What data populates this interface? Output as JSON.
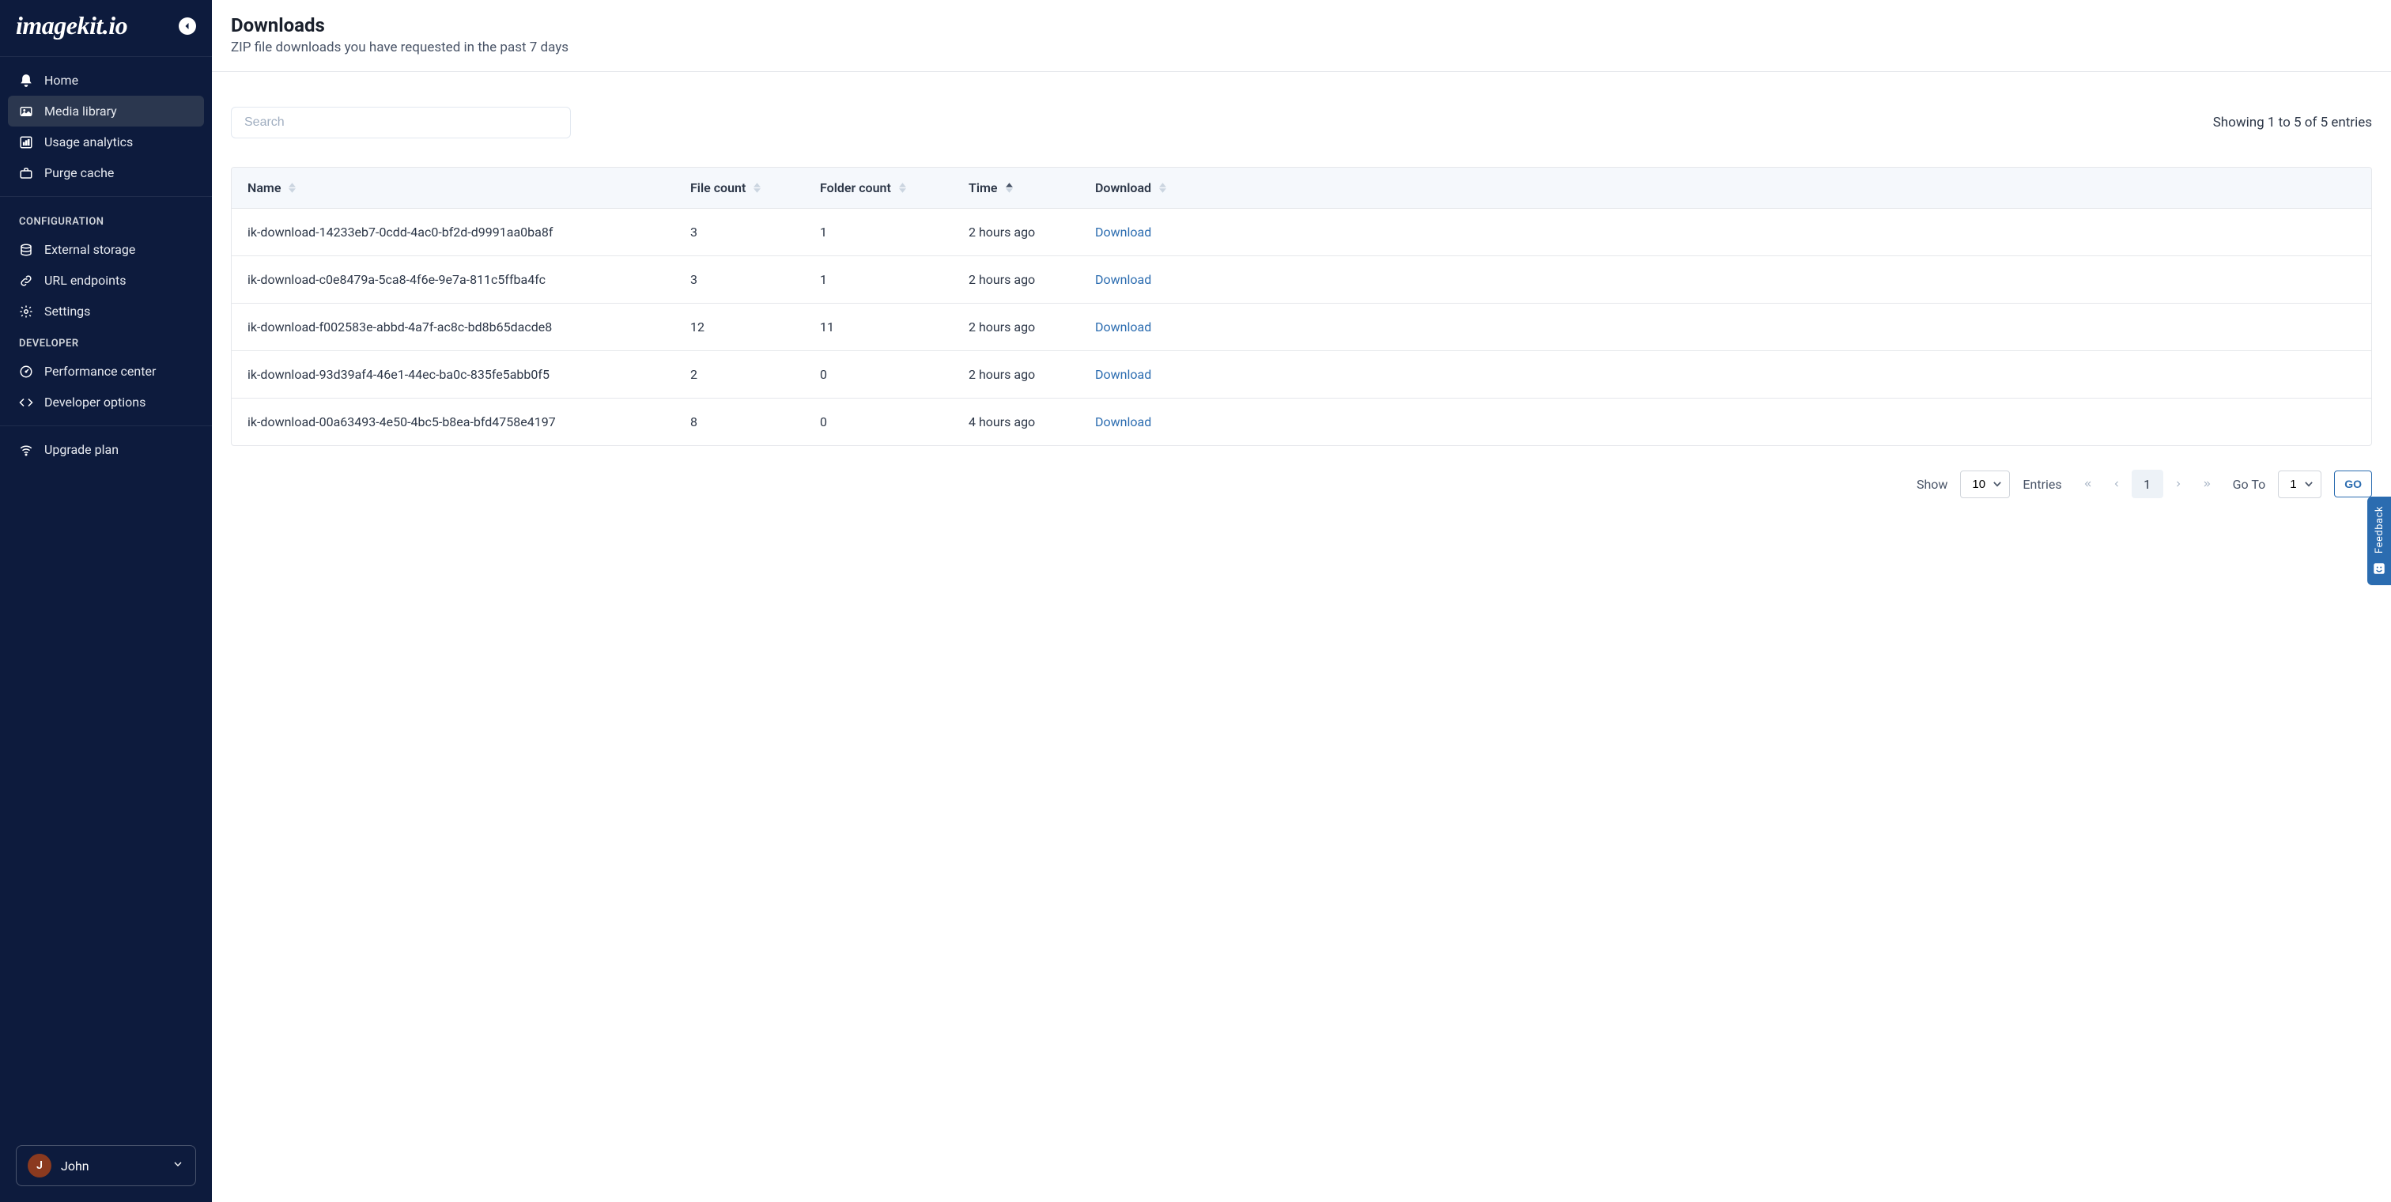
{
  "brand": "imagekit.io",
  "sidebar": {
    "items": [
      {
        "label": "Home",
        "icon": "bell-icon"
      },
      {
        "label": "Media library",
        "icon": "image-icon",
        "active": true
      },
      {
        "label": "Usage analytics",
        "icon": "chart-icon"
      },
      {
        "label": "Purge cache",
        "icon": "briefcase-icon"
      }
    ],
    "section_configuration": {
      "heading": "CONFIGURATION",
      "items": [
        {
          "label": "External storage",
          "icon": "database-icon"
        },
        {
          "label": "URL endpoints",
          "icon": "link-icon"
        },
        {
          "label": "Settings",
          "icon": "gear-icon"
        }
      ]
    },
    "section_developer": {
      "heading": "DEVELOPER",
      "items": [
        {
          "label": "Performance center",
          "icon": "gauge-icon"
        },
        {
          "label": "Developer options",
          "icon": "code-icon"
        }
      ]
    },
    "section_upgrade": {
      "items": [
        {
          "label": "Upgrade plan",
          "icon": "wifi-icon"
        }
      ]
    }
  },
  "user": {
    "initial": "J",
    "name": "John"
  },
  "page": {
    "title": "Downloads",
    "subtitle": "ZIP file downloads you have requested in the past 7 days"
  },
  "search": {
    "placeholder": "Search"
  },
  "showing_text": "Showing 1 to 5 of 5 entries",
  "table": {
    "columns": {
      "name": "Name",
      "file_count": "File count",
      "folder_count": "Folder count",
      "time": "Time",
      "download": "Download"
    },
    "download_label": "Download",
    "rows": [
      {
        "name": "ik-download-14233eb7-0cdd-4ac0-bf2d-d9991aa0ba8f",
        "file_count": "3",
        "folder_count": "1",
        "time": "2 hours ago"
      },
      {
        "name": "ik-download-c0e8479a-5ca8-4f6e-9e7a-811c5ffba4fc",
        "file_count": "3",
        "folder_count": "1",
        "time": "2 hours ago"
      },
      {
        "name": "ik-download-f002583e-abbd-4a7f-ac8c-bd8b65dacde8",
        "file_count": "12",
        "folder_count": "11",
        "time": "2 hours ago"
      },
      {
        "name": "ik-download-93d39af4-46e1-44ec-ba0c-835fe5abb0f5",
        "file_count": "2",
        "folder_count": "0",
        "time": "2 hours ago"
      },
      {
        "name": "ik-download-00a63493-4e50-4bc5-b8ea-bfd4758e4197",
        "file_count": "8",
        "folder_count": "0",
        "time": "4 hours ago"
      }
    ]
  },
  "pagination": {
    "show_label": "Show",
    "entries_label": "Entries",
    "per_page": "10",
    "current_page": "1",
    "goto_label": "Go To",
    "goto_value": "1",
    "go_button": "GO"
  },
  "feedback": {
    "label": "Feedback"
  }
}
